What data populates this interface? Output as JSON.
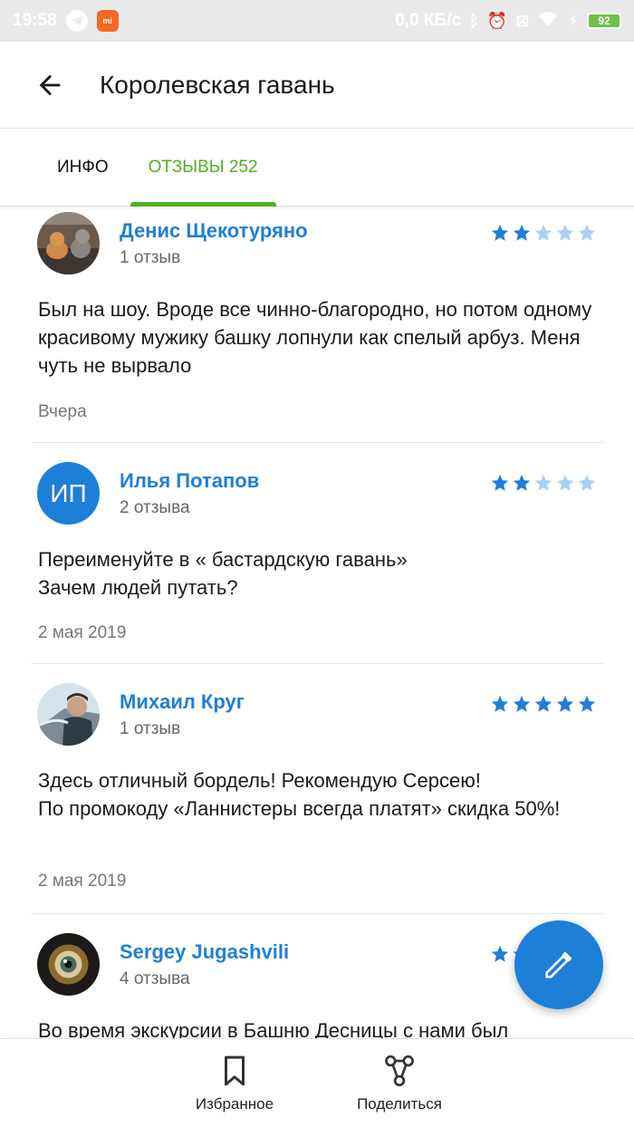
{
  "status_bar": {
    "time": "19:58",
    "speed": "0,0 КБ/с",
    "battery": "92"
  },
  "app_bar": {
    "title": "Королевская гавань"
  },
  "tabs": [
    {
      "label": "ИНФО",
      "active": false
    },
    {
      "label": "ОТЗЫВЫ 252",
      "active": true
    }
  ],
  "reviews": [
    {
      "author": "Денис Щекотуряно",
      "count": "1 отзыв",
      "rating": 2,
      "text": "Был на шоу. Вроде все чинно-благородно, но потом одному красивому мужику башку лопнули как спелый арбуз. Меня чуть не вырвало",
      "date": "Вчера",
      "avatar": "photo-cats"
    },
    {
      "author": "Илья Потапов",
      "count": "2 отзыва",
      "rating": 2,
      "text": "Переименуйте в « бастардскую гавань»\nЗачем людей путать?",
      "date": "2 мая 2019",
      "avatar_initials": "ИП"
    },
    {
      "author": "Михаил Круг",
      "count": "1 отзыв",
      "rating": 5,
      "text": "Здесь отличный бордель! Рекомендую Серсею!\nПо промокоду «Ланнистеры всегда платят» скидка 50%!",
      "date": "2 мая 2019",
      "avatar": "photo-man-in-car"
    },
    {
      "author": "Sergey Jugashvili",
      "count": "4 отзыва",
      "rating": 5,
      "text": "Во время экскурсии в Башню Десницы с нами был",
      "date": "",
      "avatar": "photo-eye"
    }
  ],
  "bottom_bar": {
    "favorites_label": "Избранное",
    "share_label": "Поделиться"
  },
  "colors": {
    "accent_green": "#52b01e",
    "link_blue": "#1e7fd8",
    "star_filled": "#1e7fd8",
    "star_empty": "#a8d0f3"
  }
}
